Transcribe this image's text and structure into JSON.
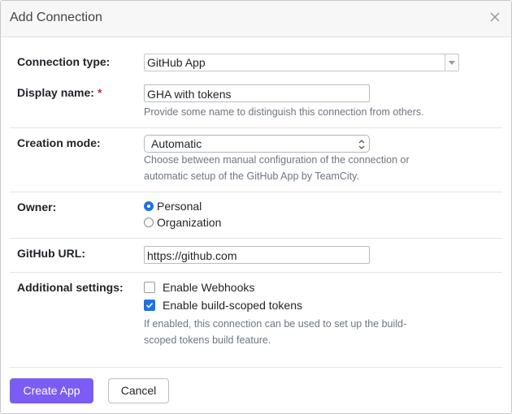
{
  "dialog": {
    "title": "Add Connection",
    "close_icon": "close-icon"
  },
  "form": {
    "connection_type": {
      "label": "Connection type:",
      "value": "GitHub App"
    },
    "display_name": {
      "label": "Display name:",
      "required_mark": "*",
      "value": "GHA with tokens",
      "help": "Provide some name to distinguish this connection from others."
    },
    "creation_mode": {
      "label": "Creation mode:",
      "value": "Automatic",
      "help_line1": "Choose between manual configuration of the connection or",
      "help_line2": "automatic setup of the GitHub App by TeamCity."
    },
    "owner": {
      "label": "Owner:",
      "options": [
        "Personal",
        "Organization"
      ],
      "selected": "Personal"
    },
    "github_url": {
      "label": "GitHub URL:",
      "value": "https://github.com"
    },
    "additional_settings": {
      "label": "Additional settings:",
      "enable_webhooks": {
        "label": "Enable Webhooks",
        "checked": false
      },
      "enable_build_scoped_tokens": {
        "label": "Enable build-scoped tokens",
        "checked": true
      },
      "help_line1": "If enabled, this connection can be used to set up the build-",
      "help_line2": "scoped tokens build feature."
    }
  },
  "footer": {
    "create_label": "Create App",
    "cancel_label": "Cancel"
  },
  "colors": {
    "primary": "#7b5cf5",
    "accent": "#1a73e8",
    "required": "#d2273b"
  }
}
